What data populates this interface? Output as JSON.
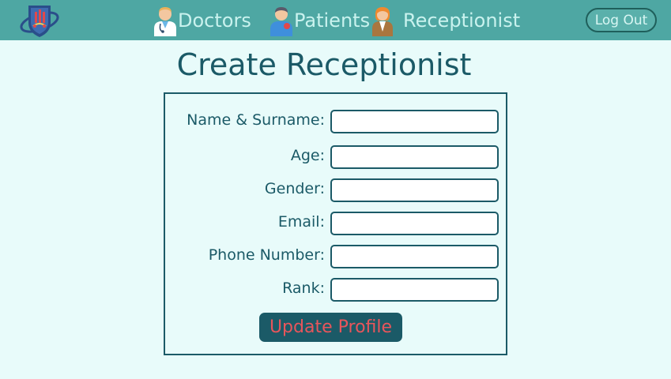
{
  "nav": {
    "logo_icon": "hospital-shield-logo-icon",
    "items": [
      {
        "label": "Doctors",
        "icon": "doctor-avatar-icon"
      },
      {
        "label": "Patients",
        "icon": "patient-avatar-icon"
      },
      {
        "label": "Receptionist",
        "icon": "receptionist-avatar-icon"
      }
    ],
    "logout_label": "Log Out"
  },
  "page": {
    "title": "Create Receptionist"
  },
  "form": {
    "fields": [
      {
        "label": "Name & Surname:",
        "value": "",
        "placeholder": ""
      },
      {
        "label": "Age:",
        "value": "",
        "placeholder": ""
      },
      {
        "label": "Gender:",
        "value": "",
        "placeholder": ""
      },
      {
        "label": "Email:",
        "value": "",
        "placeholder": ""
      },
      {
        "label": "Phone Number:",
        "value": "",
        "placeholder": ""
      },
      {
        "label": "Rank:",
        "value": "",
        "placeholder": ""
      }
    ],
    "submit_label": "Update Profile"
  },
  "colors": {
    "nav_background": "#4ea7a3",
    "page_background": "#e8fbfa",
    "primary_text": "#1b5a67",
    "button_text": "#e8555b"
  }
}
